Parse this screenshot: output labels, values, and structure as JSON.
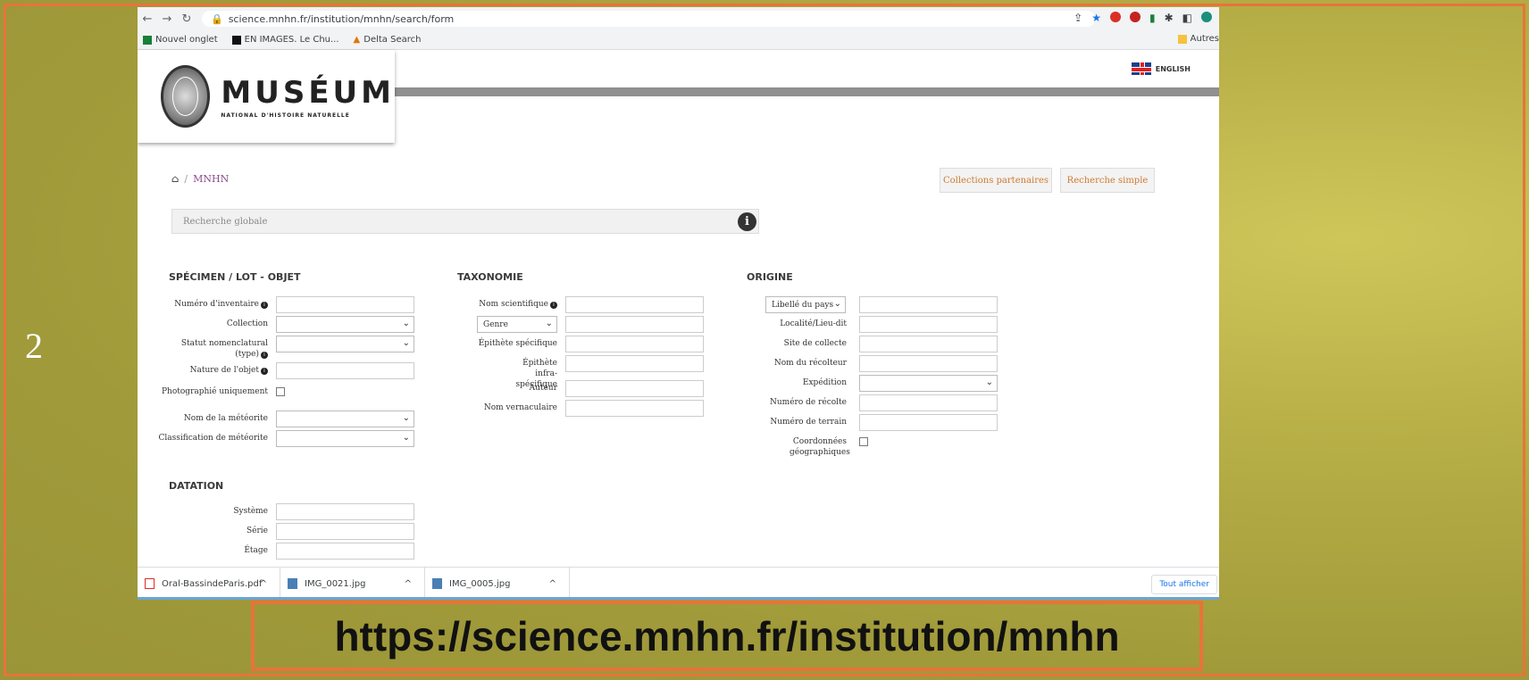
{
  "slide": {
    "number": "2",
    "caption": "https://science.mnhn.fr/institution/mnhn",
    "accent_color": "#e8733a"
  },
  "browser": {
    "url": "science.mnhn.fr/institution/mnhn/search/form",
    "bookmarks": [
      "Nouvel onglet",
      "EN IMAGES. Le Chu...",
      "Delta Search"
    ],
    "bookmarks_other": "Autres"
  },
  "site": {
    "logo_title": "MUSÉUM",
    "logo_subtitle": "NATIONAL D'HISTOIRE NATURELLE",
    "language": "ENGLISH",
    "breadcrumb_current": "MNHN",
    "btn_partners": "Collections partenaires",
    "btn_simple": "Recherche simple",
    "global_search_placeholder": "Recherche globale"
  },
  "specimen": {
    "title": "SPÉCIMEN / LOT - OBJET",
    "inventory_number": "Numéro d'inventaire",
    "collection": "Collection",
    "nomenclature_status": "Statut nomenclatural (type)",
    "object_nature": "Nature de l'objet",
    "photographed_only": "Photographié uniquement",
    "meteorite_name": "Nom de la météorite",
    "meteorite_classification": "Classification de météorite"
  },
  "taxonomy": {
    "title": "TAXONOMIE",
    "scientific_name": "Nom scientifique",
    "genus_select": "Genre",
    "specific_epithet": "Épithète spécifique",
    "infraspecific_epithet": "Épithète infra-spécifique",
    "author": "Auteur",
    "vernacular_name": "Nom vernaculaire"
  },
  "origin": {
    "title": "ORIGINE",
    "country_select": "Libellé du pays",
    "locality": "Localité/Lieu-dit",
    "collection_site": "Site de collecte",
    "collector_name": "Nom du récolteur",
    "expedition": "Expédition",
    "harvest_number": "Numéro de récolte",
    "field_number": "Numéro de terrain",
    "geo_coordinates": "Coordonnées géographiques"
  },
  "dating": {
    "title": "DATATION",
    "system": "Système",
    "series": "Série",
    "stage": "Étage"
  },
  "downloads": {
    "items": [
      "Oral-BassindeParis.pdf",
      "IMG_0021.jpg",
      "IMG_0005.jpg"
    ],
    "show_all": "Tout afficher"
  }
}
